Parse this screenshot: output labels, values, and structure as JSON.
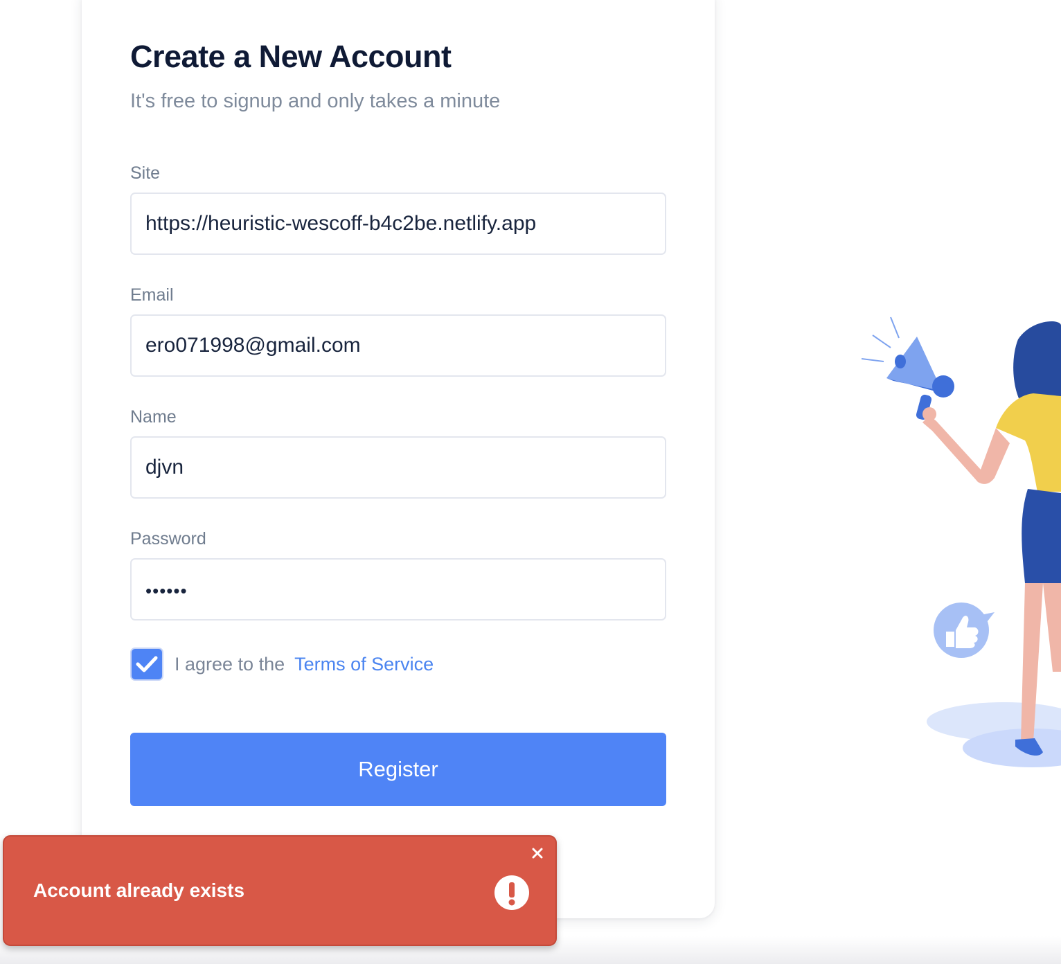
{
  "form": {
    "title": "Create a New Account",
    "subtitle": "It's free to signup and only takes a minute",
    "fields": [
      {
        "label": "Site",
        "value": "https://heuristic-wescoff-b4c2be.netlify.app"
      },
      {
        "label": "Email",
        "value": "ero071998@gmail.com"
      },
      {
        "label": "Name",
        "value": "djvn"
      },
      {
        "label": "Password",
        "value": "••••••"
      }
    ],
    "agree": {
      "checked": true,
      "text": "I agree to the",
      "link": "Terms of Service"
    },
    "register_label": "Register"
  },
  "toast": {
    "message": "Account already exists",
    "close_icon": "close-icon",
    "alert_icon": "exclamation-icon",
    "color": "#d85847"
  },
  "colors": {
    "accent": "#4f84f6",
    "title": "#0f1a35",
    "muted": "#7e8a9b",
    "error": "#d85847"
  },
  "illustration": {
    "icons": [
      "megaphone-icon",
      "thumbs-up-icon"
    ]
  }
}
